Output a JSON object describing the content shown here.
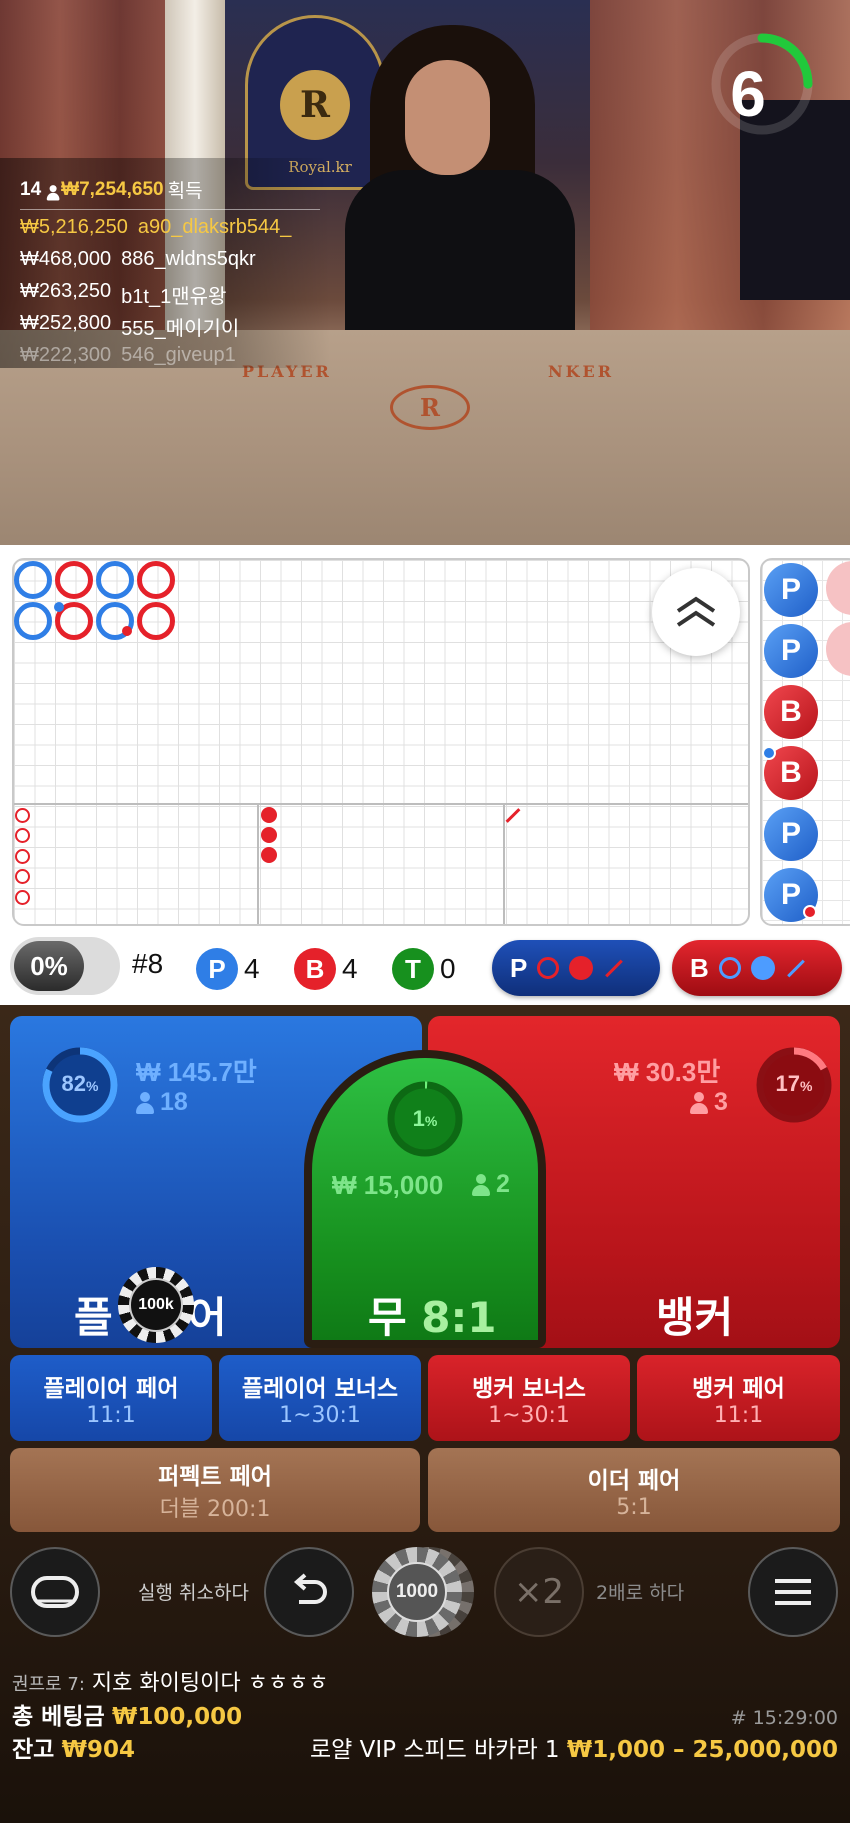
{
  "timer": {
    "seconds": "6",
    "progress": 0.25
  },
  "winners": {
    "count": "14",
    "total": "₩7,254,650",
    "suffix": "획득",
    "rows": [
      {
        "amount": "₩5,216,250",
        "name": "a90_dlaksrb544_"
      },
      {
        "amount": "₩468,000",
        "name": "886_wldns5qkr"
      },
      {
        "amount": "₩263,250",
        "name": "b1t_1맨유왕"
      },
      {
        "amount": "₩252,800",
        "name": "555_메이기이"
      },
      {
        "amount": "₩222,300",
        "name": "546_giveup1"
      }
    ]
  },
  "table": {
    "brand": "Royal.kr",
    "crest_letter": "R",
    "player_label": "PLAYER",
    "banker_label": "NKER"
  },
  "road": {
    "small_beads": [
      "P",
      "P",
      "B",
      "B",
      "P",
      "P"
    ]
  },
  "stats": {
    "toggle_pct": "0%",
    "round": "#8",
    "player_letter": "P",
    "player_count": "4",
    "banker_letter": "B",
    "banker_count": "4",
    "tie_letter": "T",
    "tie_count": "0",
    "player_ask": "P",
    "banker_ask": "B"
  },
  "bets": {
    "player": {
      "pct": "82",
      "pct_value": 0.82,
      "amount": "₩ 145.7만",
      "people": "18",
      "title_left": "플",
      "title_right": "어"
    },
    "tie": {
      "pct": "1",
      "pct_value": 0.01,
      "amount": "₩ 15,000",
      "people": "2",
      "title": "무",
      "ratio": "8:1"
    },
    "banker": {
      "pct": "17",
      "pct_value": 0.17,
      "amount": "₩ 30.3만",
      "people": "3",
      "title": "뱅커"
    },
    "chip_on_player": "100k",
    "side": [
      {
        "title": "플레이어 페어",
        "ratio": "11:1"
      },
      {
        "title": "플레이어 보너스",
        "ratio": "1~30:1"
      },
      {
        "title": "뱅커 보너스",
        "ratio": "1~30:1"
      },
      {
        "title": "뱅커 페어",
        "ratio": "11:1"
      }
    ],
    "perfect_pair": {
      "title": "퍼펙트 페어",
      "ratio": "더블 200:1"
    },
    "either_pair": {
      "title": "이더 페어",
      "ratio": "5:1"
    }
  },
  "controls": {
    "undo_label": "실행 취소하다",
    "chip_value": "1000",
    "double_symbol": "×2",
    "double_label": "2배로 하다"
  },
  "chat": {
    "name": "권프로 7:",
    "message": "지호 화이팅이다 ㅎㅎㅎㅎ"
  },
  "footer": {
    "total_bet_label": "총 베팅금",
    "total_bet": "₩100,000",
    "round_id": "# 15:29:00",
    "balance_label": "잔고",
    "balance": "₩904",
    "table_name": "로얄 VIP 스피드 바카라 1",
    "limits": "₩1,000 – 25,000,000"
  },
  "colors": {
    "player": "#2f7ee6",
    "banker": "#e5212a",
    "tie": "#17901e",
    "gold": "#f6c843"
  }
}
